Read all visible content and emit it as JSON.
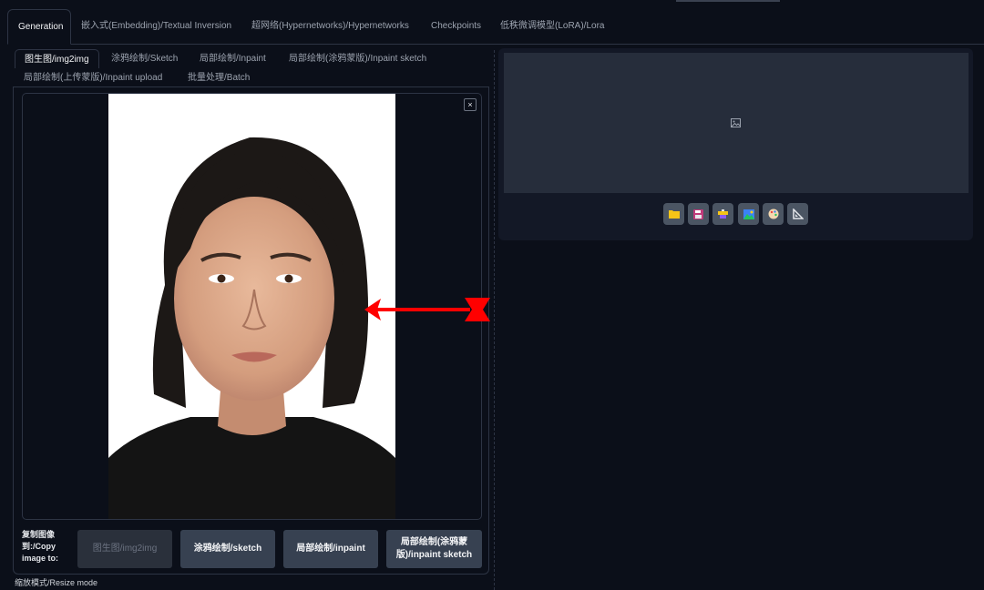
{
  "top_tabs": [
    {
      "label": "Generation",
      "active": true
    },
    {
      "label": "嵌入式(Embedding)/Textual Inversion"
    },
    {
      "label": "超网络(Hypernetworks)/Hypernetworks"
    },
    {
      "label": "Checkpoints"
    },
    {
      "label": "低秩微调模型(LoRA)/Lora"
    }
  ],
  "sub_tabs": [
    {
      "label": "图生图/img2img",
      "active": true
    },
    {
      "label": "涂鸦绘制/Sketch"
    },
    {
      "label": "局部绘制/Inpaint"
    },
    {
      "label": "局部绘制(涂鸦蒙版)/Inpaint sketch"
    },
    {
      "label": "局部绘制(上传蒙版)/Inpaint upload"
    },
    {
      "label": "批量处理/Batch"
    }
  ],
  "image_panel": {
    "close_label": "×"
  },
  "copy_image": {
    "label": "复制图像到:/Copy image to:",
    "buttons": [
      {
        "label": "图生图/img2img",
        "disabled": true
      },
      {
        "label": "涂鸦绘制/sketch"
      },
      {
        "label": "局部绘制/inpaint"
      },
      {
        "label": "局部绘制(涂鸦蒙版)/inpaint sketch"
      }
    ]
  },
  "resize_mode_label": "缩放模式/Resize mode",
  "output_tools": [
    "folder-icon",
    "save-icon",
    "zip-icon",
    "image-icon",
    "palette-icon",
    "ruler-icon"
  ],
  "colors": {
    "background": "#0b0f19",
    "panel": "#131826",
    "button": "#374151",
    "arrow": "#ff0000"
  }
}
